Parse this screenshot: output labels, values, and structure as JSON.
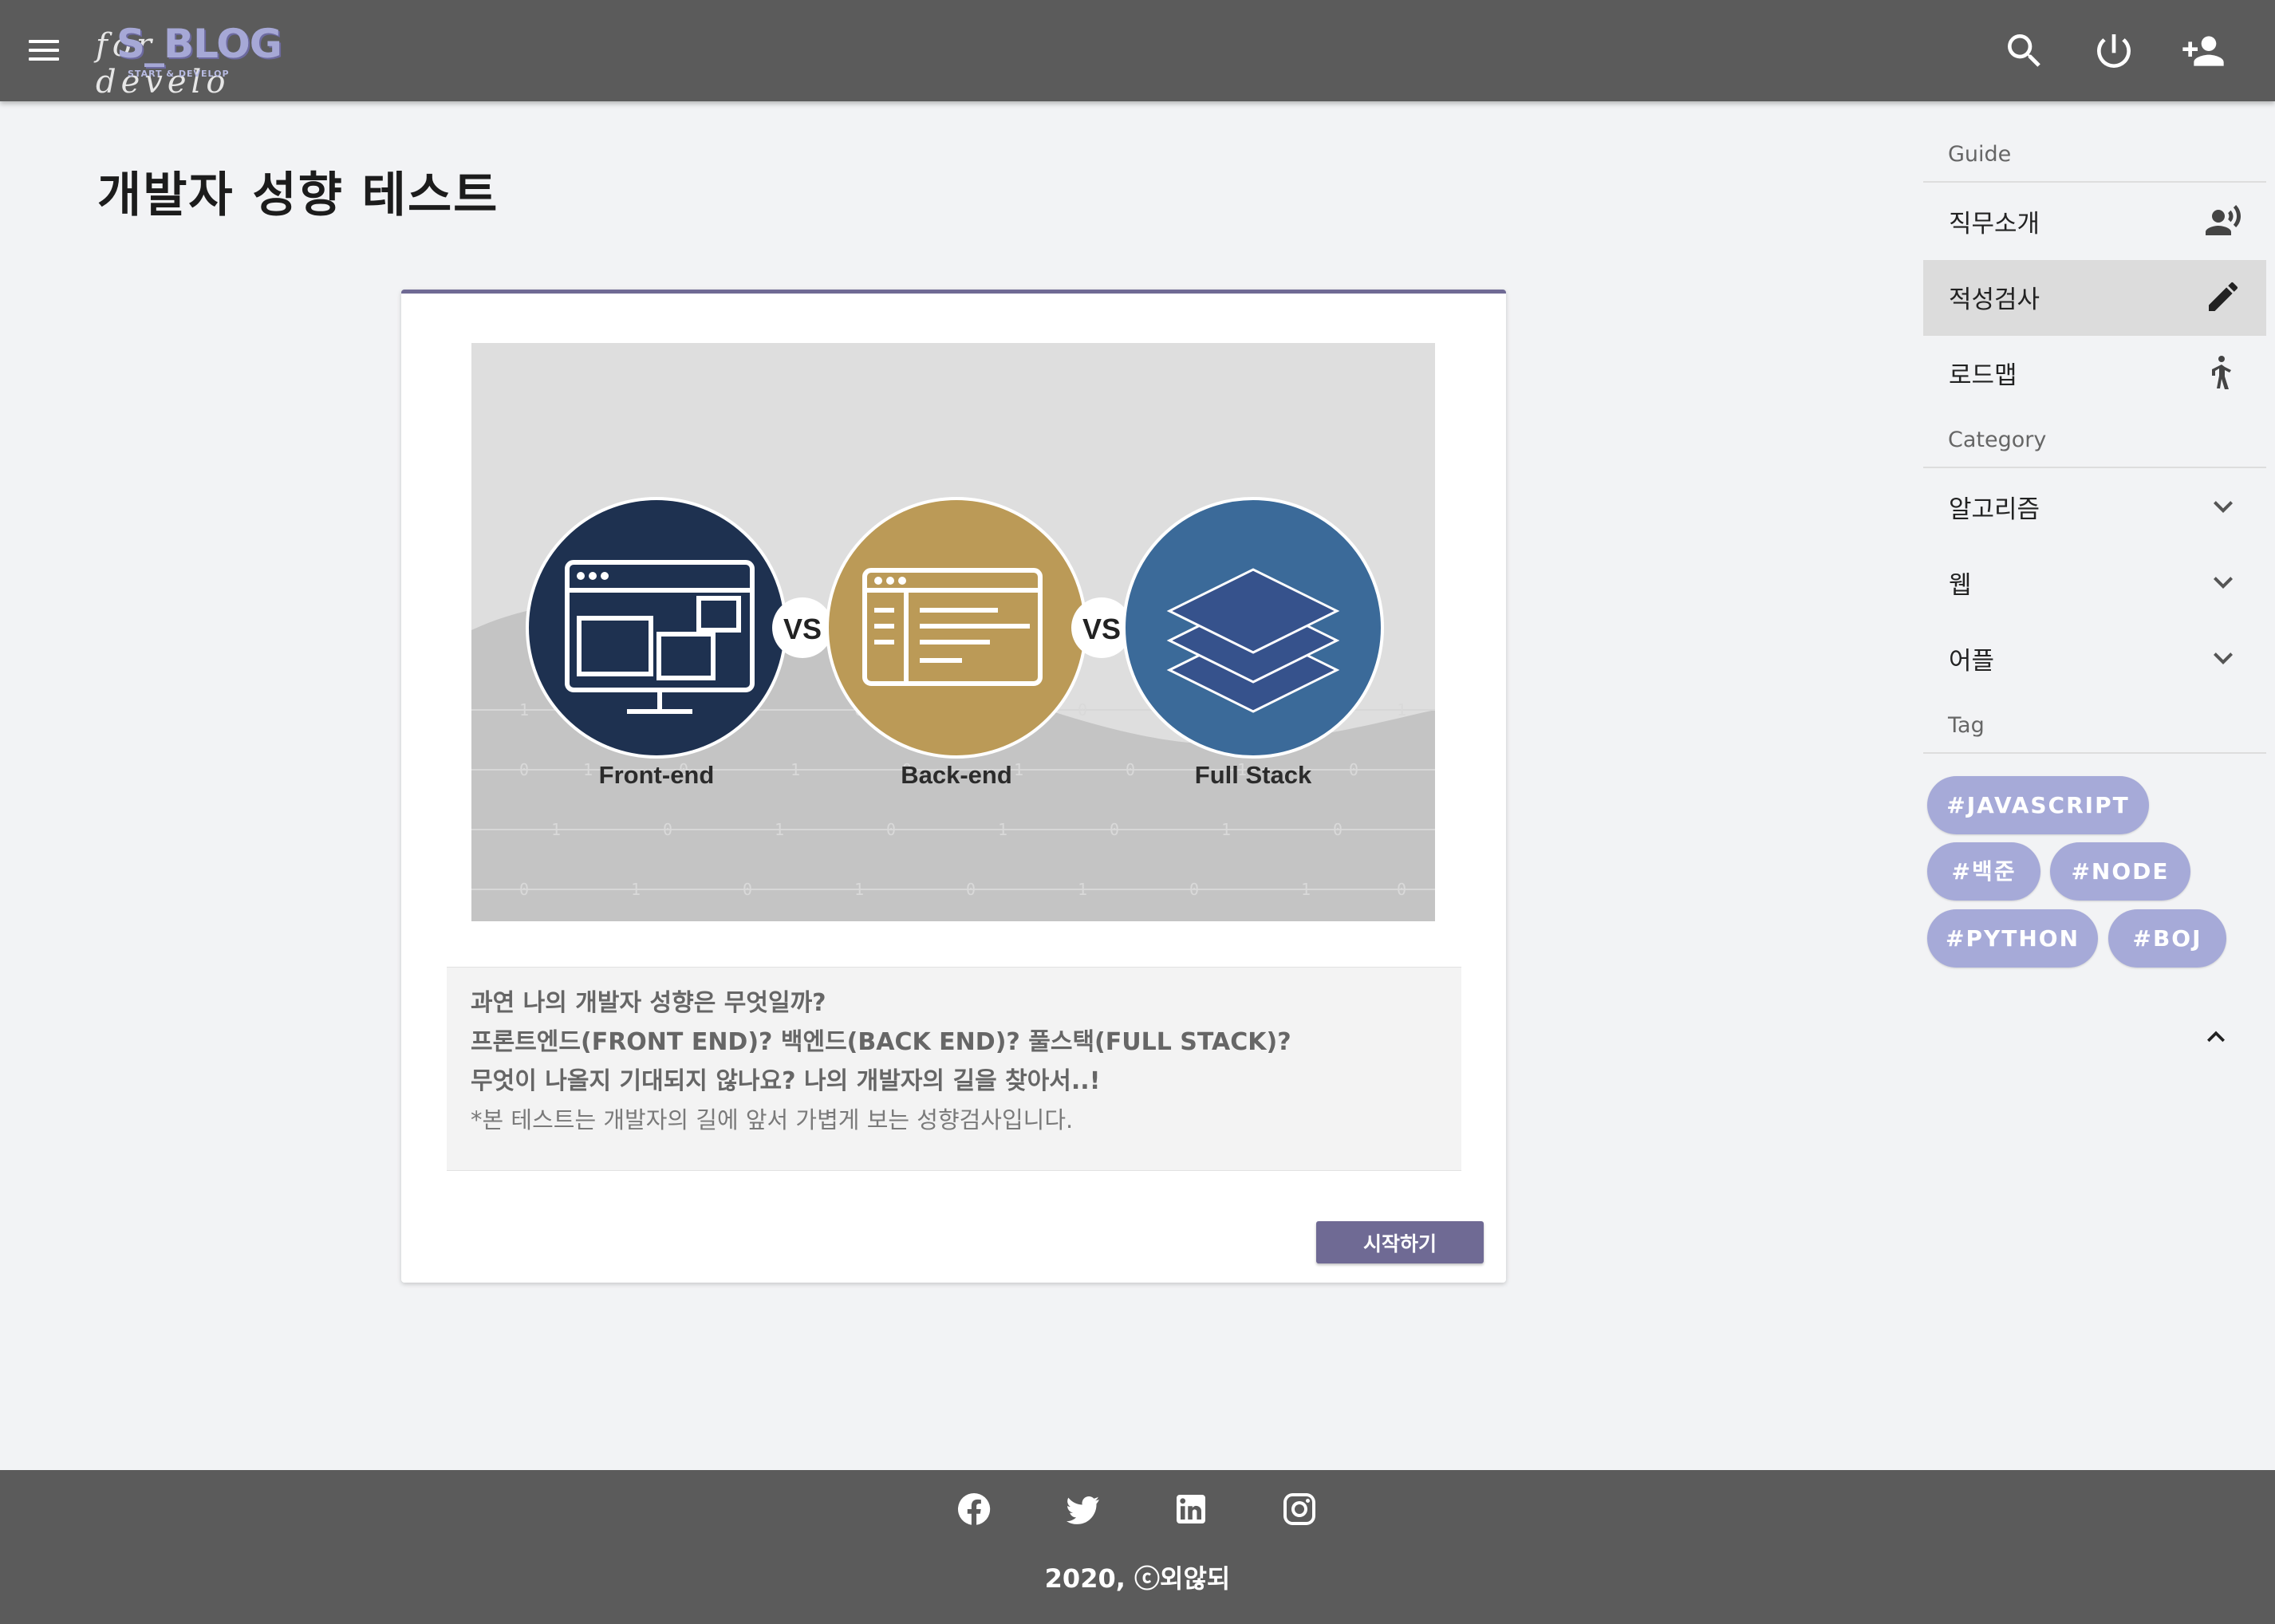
{
  "header": {
    "logo_script": "for develo",
    "logo_main": "S_BLOG",
    "logo_sub": "START & DEVELOP"
  },
  "main": {
    "page_title": "개발자 성향 테스트",
    "illustration": {
      "labels": [
        "Front-end",
        "Back-end",
        "Full Stack"
      ],
      "vs": [
        "VS",
        "VS"
      ],
      "colors": {
        "frontend": "#1e3150",
        "backend": "#bb9a57",
        "fullstack": "#3b6a99"
      }
    },
    "description": {
      "line1": "과연 나의 개발자 성향은 무엇일까?",
      "line2": "프론트엔드(FRONT END)? 백엔드(BACK END)? 풀스택(FULL STACK)?",
      "line3": "무엇이 나올지 기대되지 않나요? 나의 개발자의 길을 찾아서..!",
      "note": "*본 테스트는 개발자의 길에 앞서 가볍게 보는 성향검사입니다."
    },
    "start_button": "시작하기"
  },
  "sidebar": {
    "guide_header": "Guide",
    "guide_items": [
      {
        "label": "직무소개",
        "icon": "record-voice-icon"
      },
      {
        "label": "적성검사",
        "icon": "pencil-icon",
        "active": true
      },
      {
        "label": "로드맵",
        "icon": "walking-person-icon"
      }
    ],
    "category_header": "Category",
    "category_items": [
      {
        "label": "알고리즘",
        "icon": "chevron-down-icon"
      },
      {
        "label": "웹",
        "icon": "chevron-down-icon"
      },
      {
        "label": "어플",
        "icon": "chevron-down-icon"
      }
    ],
    "tag_header": "Tag",
    "tags": [
      "#JAVASCRIPT",
      "#백준",
      "#NODE",
      "#PYTHON",
      "#BOJ"
    ]
  },
  "footer": {
    "copyright": "2020, ⓒ외않되"
  },
  "colors": {
    "topbar": "#5b5b5b",
    "accent": "#6f6a94",
    "tag_bg": "#a6aad8",
    "page_bg": "#f2f3f5"
  }
}
